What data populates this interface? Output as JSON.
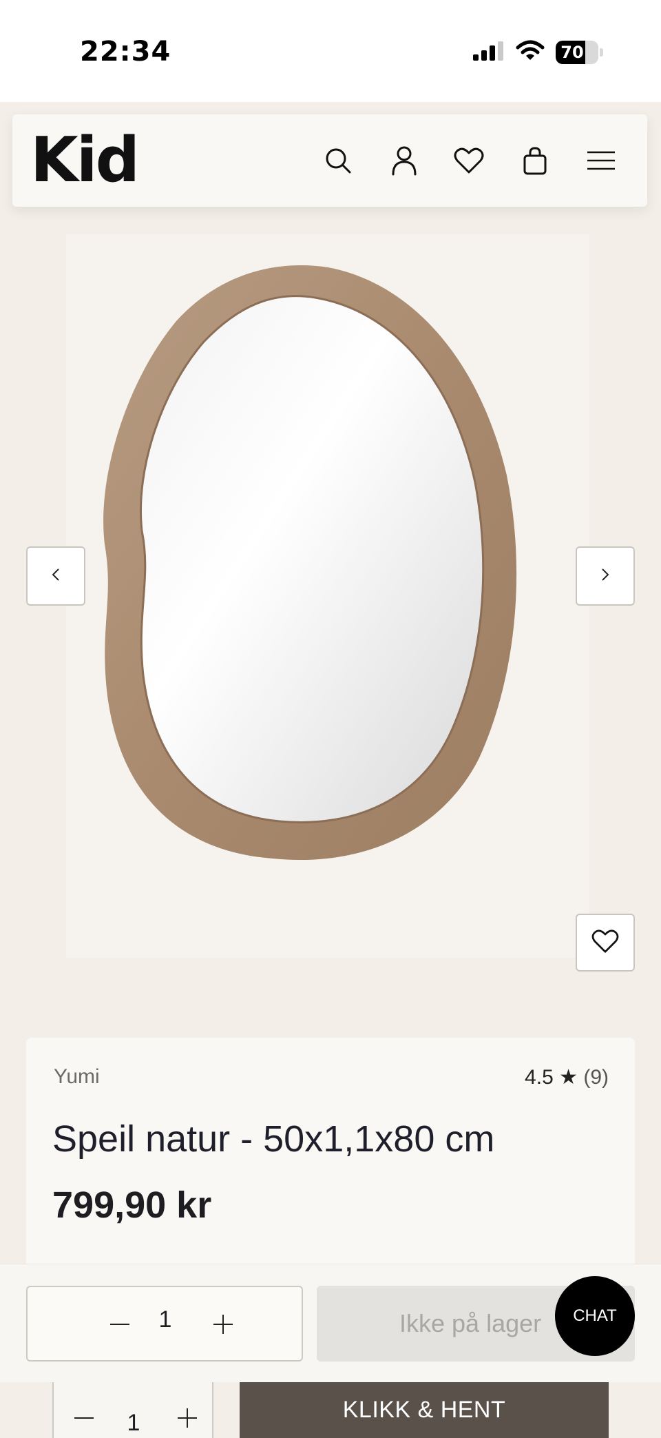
{
  "status_bar": {
    "time": "22:34",
    "battery": "70",
    "battery_level": 0.7,
    "icons": [
      "signal-icon",
      "wifi-icon",
      "battery-icon"
    ]
  },
  "header": {
    "logo": "Kid",
    "icons": [
      "search-icon",
      "account-icon",
      "wishlist-icon",
      "cart-icon",
      "menu-icon"
    ]
  },
  "gallery": {
    "prev_icon": "chevron-left-icon",
    "next_icon": "chevron-right-icon",
    "favorite_icon": "heart-icon"
  },
  "product": {
    "brand": "Yumi",
    "rating": "4.5 ★",
    "review_count": "(9)",
    "title": "Speil natur - 50x1,1x80 cm",
    "price": "799,90 kr"
  },
  "purchase_bar": {
    "quantity": "1",
    "stock_button": "Ikke på lager",
    "chat_label": "CHAT"
  },
  "secondary_bar": {
    "quantity": "1",
    "click_collect": "KLIKK & HENT"
  },
  "colors": {
    "page_bg": "#f3efe8",
    "header_bg": "#faf8f4",
    "click_collect_bg": "#5a514b",
    "stock_button_bg": "#e4e2de"
  }
}
